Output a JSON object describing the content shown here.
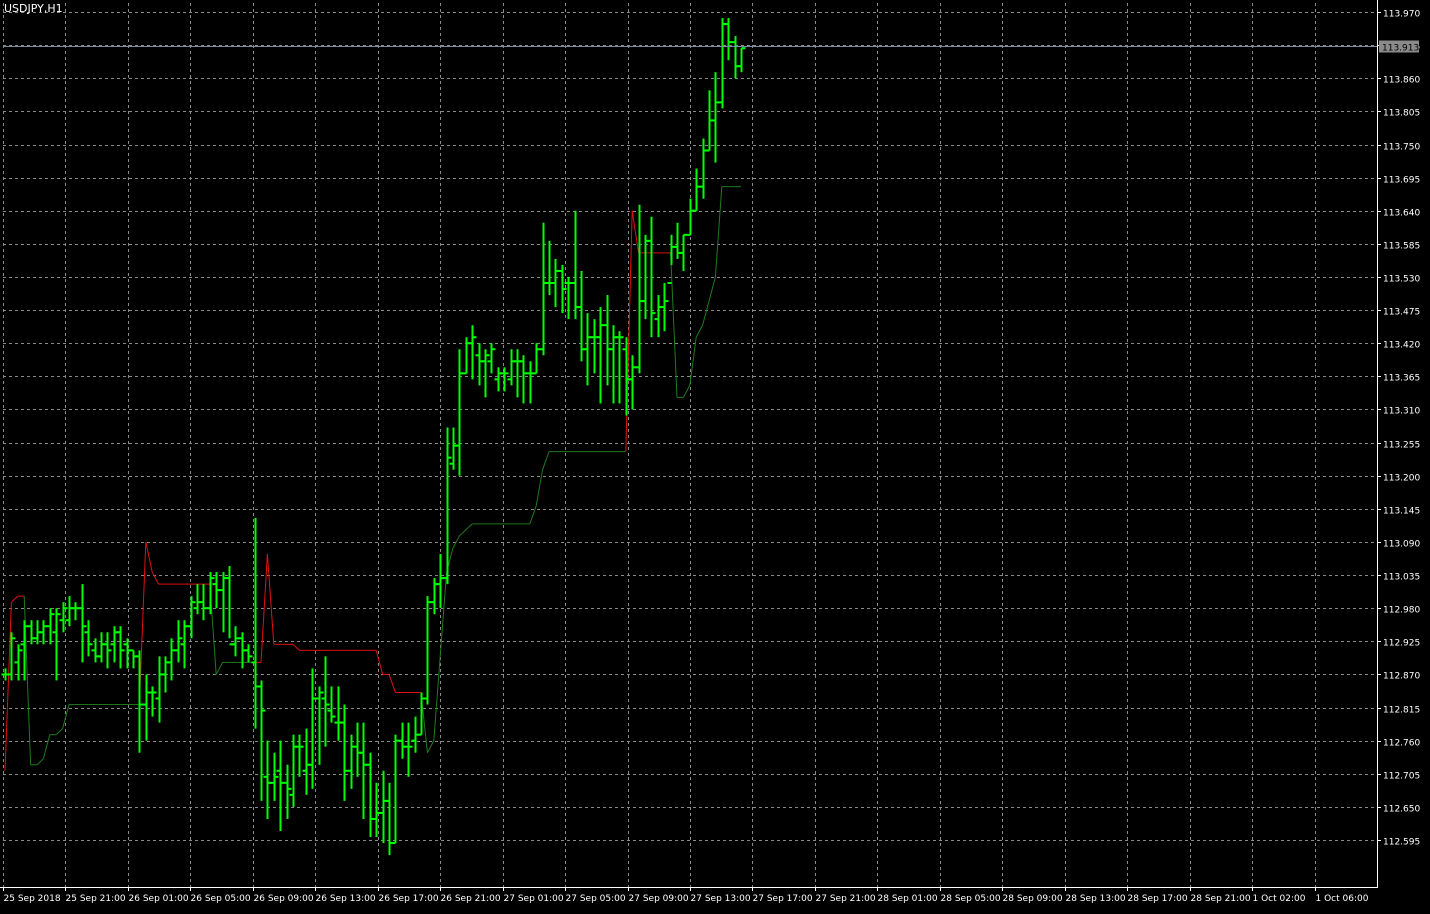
{
  "window": {
    "symbol_label": "USDJPY,H1"
  },
  "colors": {
    "background": "#000000",
    "grid": "#8a8a8a",
    "axis": "#ffffff",
    "bar": "#00ff00",
    "trail_bull": "#1f7a1f",
    "trail_bear": "#e01010",
    "price_line": "#7a8aa0",
    "price_tag_bg": "#8a8a8a",
    "price_tag_text": "#000000"
  },
  "chart_data": {
    "type": "ohlc",
    "symbol": "USDJPY",
    "timeframe": "H1",
    "ylim": [
      112.517,
      113.985
    ],
    "y_ticks": [
      "113.970",
      "113.915",
      "113.860",
      "113.805",
      "113.750",
      "113.695",
      "113.640",
      "113.585",
      "113.530",
      "113.475",
      "113.420",
      "113.365",
      "113.310",
      "113.255",
      "113.200",
      "113.145",
      "113.090",
      "113.035",
      "112.980",
      "112.925",
      "112.870",
      "112.815",
      "112.760",
      "112.705",
      "112.650",
      "112.595"
    ],
    "x_ticks": [
      "25 Sep 2018",
      "25 Sep 21:00",
      "26 Sep 01:00",
      "26 Sep 05:00",
      "26 Sep 09:00",
      "26 Sep 13:00",
      "26 Sep 17:00",
      "26 Sep 21:00",
      "27 Sep 01:00",
      "27 Sep 05:00",
      "27 Sep 09:00",
      "27 Sep 13:00",
      "27 Sep 17:00",
      "27 Sep 21:00",
      "28 Sep 01:00",
      "28 Sep 05:00",
      "28 Sep 09:00",
      "28 Sep 13:00",
      "28 Sep 17:00",
      "28 Sep 21:00",
      "1 Oct 02:00",
      "1 Oct 06:00"
    ],
    "current_price": "113.913",
    "bars": [
      [
        112.87,
        112.88,
        112.86,
        112.87
      ],
      [
        112.87,
        112.94,
        112.86,
        112.93
      ],
      [
        112.89,
        112.92,
        112.86,
        112.91
      ],
      [
        112.92,
        112.96,
        112.86,
        112.95
      ],
      [
        112.95,
        112.96,
        112.92,
        112.93
      ],
      [
        112.93,
        112.96,
        112.92,
        112.94
      ],
      [
        112.94,
        112.96,
        112.92,
        112.95
      ],
      [
        112.95,
        112.98,
        112.92,
        112.97
      ],
      [
        112.94,
        112.98,
        112.86,
        112.97
      ],
      [
        112.96,
        112.99,
        112.94,
        112.98
      ],
      [
        112.96,
        113.0,
        112.95,
        112.98
      ],
      [
        112.98,
        112.99,
        112.96,
        112.98
      ],
      [
        112.98,
        113.02,
        112.89,
        112.95
      ],
      [
        112.94,
        112.96,
        112.9,
        112.92
      ],
      [
        112.91,
        112.93,
        112.89,
        112.9
      ],
      [
        112.9,
        112.94,
        112.89,
        112.92
      ],
      [
        112.92,
        112.94,
        112.88,
        112.91
      ],
      [
        112.92,
        112.95,
        112.89,
        112.94
      ],
      [
        112.94,
        112.95,
        112.88,
        112.91
      ],
      [
        112.92,
        112.93,
        112.88,
        112.91
      ],
      [
        112.91,
        112.91,
        112.88,
        112.9
      ],
      [
        112.9,
        112.91,
        112.74,
        112.82
      ],
      [
        112.82,
        112.87,
        112.76,
        112.84
      ],
      [
        112.84,
        112.85,
        112.8,
        112.84
      ],
      [
        112.83,
        112.9,
        112.79,
        112.87
      ],
      [
        112.87,
        112.9,
        112.84,
        112.89
      ],
      [
        112.89,
        112.93,
        112.86,
        112.91
      ],
      [
        112.91,
        112.96,
        112.89,
        112.93
      ],
      [
        112.92,
        112.96,
        112.88,
        112.95
      ],
      [
        112.95,
        113.0,
        112.93,
        112.99
      ],
      [
        112.98,
        113.02,
        112.97,
        112.99
      ],
      [
        112.99,
        113.02,
        112.96,
        112.98
      ],
      [
        112.98,
        113.04,
        112.97,
        113.03
      ],
      [
        113.02,
        113.04,
        112.98,
        113.01
      ],
      [
        113.01,
        113.04,
        112.94,
        113.03
      ],
      [
        113.03,
        113.05,
        112.93,
        112.92
      ],
      [
        112.92,
        112.95,
        112.9,
        112.93
      ],
      [
        112.93,
        112.94,
        112.88,
        112.91
      ],
      [
        112.91,
        112.92,
        112.89,
        112.9
      ],
      [
        112.89,
        113.13,
        112.78,
        112.85
      ],
      [
        112.85,
        112.86,
        112.66,
        112.81
      ],
      [
        112.7,
        112.76,
        112.63,
        112.69
      ],
      [
        112.69,
        112.74,
        112.66,
        112.7
      ],
      [
        112.71,
        112.76,
        112.61,
        112.69
      ],
      [
        112.69,
        112.72,
        112.63,
        112.68
      ],
      [
        112.67,
        112.77,
        112.65,
        112.75
      ],
      [
        112.75,
        112.77,
        112.7,
        112.75
      ],
      [
        112.71,
        112.78,
        112.67,
        112.72
      ],
      [
        112.72,
        112.88,
        112.68,
        112.83
      ],
      [
        112.83,
        112.85,
        112.72,
        112.84
      ],
      [
        112.83,
        112.9,
        112.75,
        112.82
      ],
      [
        112.81,
        112.85,
        112.79,
        112.8
      ],
      [
        112.79,
        112.85,
        112.76,
        112.79
      ],
      [
        112.79,
        112.82,
        112.66,
        112.71
      ],
      [
        112.71,
        112.77,
        112.68,
        112.75
      ],
      [
        112.75,
        112.79,
        112.7,
        112.74
      ],
      [
        112.74,
        112.79,
        112.63,
        112.72
      ],
      [
        112.72,
        112.74,
        112.6,
        112.63
      ],
      [
        112.63,
        112.69,
        112.6,
        112.64
      ],
      [
        112.64,
        112.71,
        112.59,
        112.66
      ],
      [
        112.66,
        112.69,
        112.57,
        112.59
      ],
      [
        112.59,
        112.77,
        112.59,
        112.76
      ],
      [
        112.76,
        112.79,
        112.73,
        112.75
      ],
      [
        112.75,
        112.79,
        112.7,
        112.75
      ],
      [
        112.76,
        112.8,
        112.74,
        112.77
      ],
      [
        112.77,
        112.84,
        112.77,
        112.83
      ],
      [
        112.83,
        113.0,
        112.82,
        112.99
      ],
      [
        112.99,
        113.03,
        112.97,
        113.02
      ],
      [
        113.02,
        113.07,
        112.98,
        113.03
      ],
      [
        113.03,
        113.28,
        113.02,
        113.23
      ],
      [
        113.22,
        113.28,
        113.21,
        113.25
      ],
      [
        113.25,
        113.41,
        113.2,
        113.37
      ],
      [
        113.37,
        113.43,
        113.37,
        113.42
      ],
      [
        113.42,
        113.45,
        113.36,
        113.43
      ],
      [
        113.4,
        113.42,
        113.35,
        113.39
      ],
      [
        113.39,
        113.41,
        113.33,
        113.4
      ],
      [
        113.39,
        113.42,
        113.37,
        113.41
      ],
      [
        113.36,
        113.38,
        113.34,
        113.37
      ],
      [
        113.37,
        113.38,
        113.34,
        113.37
      ],
      [
        113.36,
        113.41,
        113.35,
        113.39
      ],
      [
        113.39,
        113.41,
        113.33,
        113.39
      ],
      [
        113.39,
        113.4,
        113.32,
        113.37
      ],
      [
        113.37,
        113.39,
        113.32,
        113.37
      ],
      [
        113.37,
        113.42,
        113.37,
        113.41
      ],
      [
        113.41,
        113.62,
        113.4,
        113.52
      ],
      [
        113.52,
        113.59,
        113.5,
        113.52
      ],
      [
        113.52,
        113.56,
        113.48,
        113.54
      ],
      [
        113.54,
        113.55,
        113.47,
        113.51
      ],
      [
        113.52,
        113.53,
        113.46,
        113.52
      ],
      [
        113.52,
        113.64,
        113.46,
        113.48
      ],
      [
        113.48,
        113.54,
        113.39,
        113.41
      ],
      [
        113.41,
        113.47,
        113.35,
        113.43
      ],
      [
        113.43,
        113.46,
        113.37,
        113.43
      ],
      [
        113.43,
        113.48,
        113.32,
        113.45
      ],
      [
        113.45,
        113.5,
        113.35,
        113.41
      ],
      [
        113.41,
        113.45,
        113.32,
        113.43
      ],
      [
        113.43,
        113.44,
        113.32,
        113.43
      ],
      [
        113.41,
        113.43,
        113.3,
        113.36
      ],
      [
        113.36,
        113.4,
        113.31,
        113.38
      ],
      [
        113.38,
        113.65,
        113.37,
        113.49
      ],
      [
        113.49,
        113.6,
        113.46,
        113.59
      ],
      [
        113.59,
        113.63,
        113.43,
        113.47
      ],
      [
        113.46,
        113.5,
        113.43,
        113.48
      ],
      [
        113.48,
        113.52,
        113.44,
        113.49
      ],
      [
        113.52,
        113.6,
        113.55,
        113.58
      ],
      [
        113.58,
        113.62,
        113.56,
        113.57
      ],
      [
        113.57,
        113.6,
        113.54,
        113.6
      ],
      [
        113.6,
        113.66,
        113.6,
        113.64
      ],
      [
        113.64,
        113.71,
        113.64,
        113.68
      ],
      [
        113.68,
        113.76,
        113.66,
        113.74
      ],
      [
        113.74,
        113.84,
        113.74,
        113.79
      ],
      [
        113.79,
        113.87,
        113.72,
        113.82
      ],
      [
        113.82,
        113.96,
        113.81,
        113.95
      ],
      [
        113.95,
        113.96,
        113.89,
        113.92
      ],
      [
        113.92,
        113.93,
        113.86,
        113.88
      ],
      [
        113.88,
        113.91,
        113.87,
        113.91
      ]
    ],
    "trail": [
      [
        0,
        112.71,
        "bear"
      ],
      [
        1,
        112.99,
        "bear"
      ],
      [
        2,
        113.0,
        "bear"
      ],
      [
        3,
        113.0,
        "bear"
      ],
      [
        4,
        112.72,
        "bull"
      ],
      [
        5,
        112.72,
        "bull"
      ],
      [
        6,
        112.73,
        "bull"
      ],
      [
        7,
        112.77,
        "bull"
      ],
      [
        8,
        112.77,
        "bull"
      ],
      [
        9,
        112.78,
        "bull"
      ],
      [
        10,
        112.82,
        "bull"
      ],
      [
        11,
        112.82,
        "bull"
      ],
      [
        12,
        112.82,
        "bull"
      ],
      [
        13,
        112.82,
        "bull"
      ],
      [
        14,
        112.82,
        "bull"
      ],
      [
        15,
        112.82,
        "bull"
      ],
      [
        16,
        112.82,
        "bull"
      ],
      [
        17,
        112.82,
        "bull"
      ],
      [
        18,
        112.82,
        "bull"
      ],
      [
        19,
        112.82,
        "bull"
      ],
      [
        20,
        112.82,
        "bull"
      ],
      [
        21,
        112.82,
        "bull"
      ],
      [
        22,
        113.09,
        "bear"
      ],
      [
        23,
        113.04,
        "bear"
      ],
      [
        24,
        113.02,
        "bear"
      ],
      [
        25,
        113.02,
        "bear"
      ],
      [
        26,
        113.02,
        "bear"
      ],
      [
        27,
        113.02,
        "bear"
      ],
      [
        28,
        113.02,
        "bear"
      ],
      [
        29,
        113.02,
        "bear"
      ],
      [
        30,
        113.02,
        "bear"
      ],
      [
        31,
        113.02,
        "bear"
      ],
      [
        32,
        113.02,
        "bear"
      ],
      [
        33,
        112.87,
        "bull"
      ],
      [
        34,
        112.89,
        "bull"
      ],
      [
        35,
        112.89,
        "bull"
      ],
      [
        36,
        112.89,
        "bull"
      ],
      [
        37,
        112.89,
        "bull"
      ],
      [
        38,
        112.89,
        "bull"
      ],
      [
        39,
        112.89,
        "bull"
      ],
      [
        40,
        112.89,
        "bear"
      ],
      [
        41,
        113.07,
        "bear"
      ],
      [
        42,
        112.92,
        "bear"
      ],
      [
        43,
        112.92,
        "bear"
      ],
      [
        44,
        112.92,
        "bear"
      ],
      [
        45,
        112.92,
        "bear"
      ],
      [
        46,
        112.91,
        "bear"
      ],
      [
        47,
        112.91,
        "bear"
      ],
      [
        48,
        112.91,
        "bear"
      ],
      [
        49,
        112.91,
        "bear"
      ],
      [
        50,
        112.91,
        "bear"
      ],
      [
        51,
        112.91,
        "bear"
      ],
      [
        52,
        112.91,
        "bear"
      ],
      [
        53,
        112.91,
        "bear"
      ],
      [
        54,
        112.91,
        "bear"
      ],
      [
        55,
        112.91,
        "bear"
      ],
      [
        56,
        112.91,
        "bear"
      ],
      [
        57,
        112.91,
        "bear"
      ],
      [
        58,
        112.91,
        "bear"
      ],
      [
        59,
        112.87,
        "bear"
      ],
      [
        60,
        112.87,
        "bear"
      ],
      [
        61,
        112.84,
        "bear"
      ],
      [
        62,
        112.84,
        "bear"
      ],
      [
        63,
        112.84,
        "bear"
      ],
      [
        64,
        112.84,
        "bear"
      ],
      [
        65,
        112.84,
        "bear"
      ],
      [
        66,
        112.74,
        "bull"
      ],
      [
        67,
        112.76,
        "bull"
      ],
      [
        68,
        112.9,
        "bull"
      ],
      [
        69,
        113.04,
        "bull"
      ],
      [
        70,
        113.08,
        "bull"
      ],
      [
        71,
        113.1,
        "bull"
      ],
      [
        72,
        113.11,
        "bull"
      ],
      [
        73,
        113.12,
        "bull"
      ],
      [
        74,
        113.12,
        "bull"
      ],
      [
        75,
        113.12,
        "bull"
      ],
      [
        76,
        113.12,
        "bull"
      ],
      [
        77,
        113.12,
        "bull"
      ],
      [
        78,
        113.12,
        "bull"
      ],
      [
        79,
        113.12,
        "bull"
      ],
      [
        80,
        113.12,
        "bull"
      ],
      [
        81,
        113.12,
        "bull"
      ],
      [
        82,
        113.12,
        "bull"
      ],
      [
        83,
        113.15,
        "bull"
      ],
      [
        84,
        113.21,
        "bull"
      ],
      [
        85,
        113.24,
        "bull"
      ],
      [
        86,
        113.24,
        "bull"
      ],
      [
        87,
        113.24,
        "bull"
      ],
      [
        88,
        113.24,
        "bull"
      ],
      [
        89,
        113.24,
        "bull"
      ],
      [
        90,
        113.24,
        "bull"
      ],
      [
        91,
        113.24,
        "bull"
      ],
      [
        92,
        113.24,
        "bull"
      ],
      [
        93,
        113.24,
        "bull"
      ],
      [
        94,
        113.24,
        "bull"
      ],
      [
        95,
        113.24,
        "bull"
      ],
      [
        96,
        113.24,
        "bull"
      ],
      [
        97,
        113.24,
        "bull"
      ],
      [
        98,
        113.64,
        "bear"
      ],
      [
        99,
        113.57,
        "bear"
      ],
      [
        100,
        113.57,
        "bear"
      ],
      [
        101,
        113.57,
        "bear"
      ],
      [
        102,
        113.57,
        "bear"
      ],
      [
        103,
        113.57,
        "bear"
      ],
      [
        104,
        113.57,
        "bear"
      ],
      [
        105,
        113.33,
        "bull"
      ],
      [
        106,
        113.33,
        "bull"
      ],
      [
        107,
        113.35,
        "bull"
      ],
      [
        108,
        113.43,
        "bull"
      ],
      [
        109,
        113.45,
        "bull"
      ],
      [
        110,
        113.49,
        "bull"
      ],
      [
        111,
        113.53,
        "bull"
      ],
      [
        112,
        113.68,
        "bull"
      ],
      [
        113,
        113.68,
        "bull"
      ],
      [
        114,
        113.68,
        "bull"
      ],
      [
        115,
        113.68,
        "bull"
      ]
    ]
  }
}
